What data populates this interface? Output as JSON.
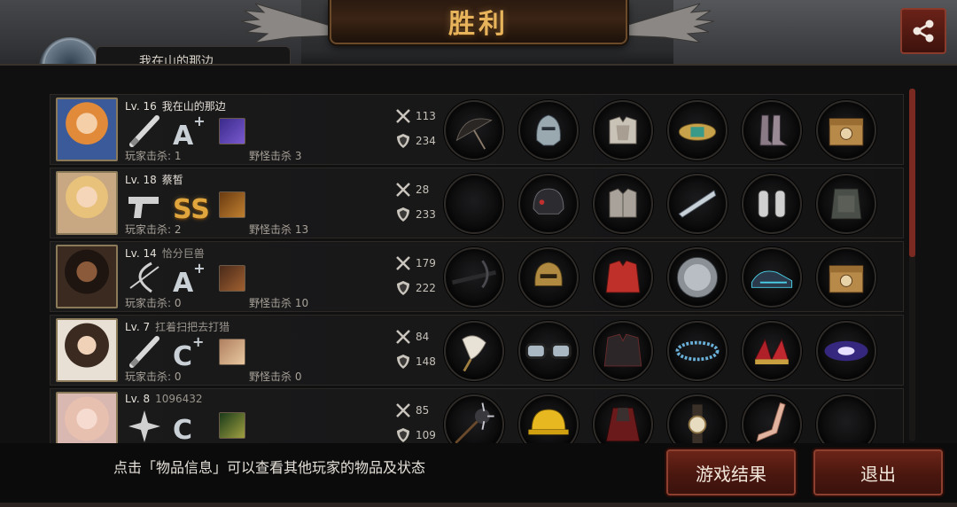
{
  "title": "胜利",
  "top_tab_text": "我在山的那边",
  "hint": "点击「物品信息」可以查看其他玩家的物品及状态",
  "buttons": {
    "result": "游戏结果",
    "exit": "退出"
  },
  "labels": {
    "player_kills": "玩家击杀",
    "monster_kills": "野怪击杀"
  },
  "colors": {
    "title": "#e7b35b",
    "button": "#6b2418",
    "ss_grade": "#e0a53c"
  },
  "players": [
    {
      "level": "Lv. 16",
      "name": "我在山的那边",
      "name_dim": false,
      "weapon": "bat-icon",
      "grade": "A",
      "grade_plus": "+",
      "grade_style": "normal",
      "skill": "skill-purple-icon",
      "player_kills": ": 1",
      "monster_kills": " 3",
      "attack": "113",
      "defense": "234",
      "items": [
        "umbrella-icon",
        "knight-helmet-icon",
        "plate-armor-icon",
        "gold-bracer-icon",
        "leather-boots-icon",
        "supply-crate-icon"
      ]
    },
    {
      "level": "Lv. 18",
      "name": "蔡皙",
      "name_dim": false,
      "weapon": "pistol-icon",
      "grade": "SS",
      "grade_plus": "",
      "grade_style": "ss",
      "skill": "skill-orange-icon",
      "player_kills": ": 2",
      "monster_kills": " 13",
      "attack": "28",
      "defense": "233",
      "items": [
        "",
        "tactical-helmet-icon",
        "chest-armor-icon",
        "drill-blade-icon",
        "knee-guards-icon",
        "vest-icon"
      ]
    },
    {
      "level": "Lv. 14",
      "name": "恰分巨兽",
      "name_dim": true,
      "weapon": "bow-icon",
      "grade": "A",
      "grade_plus": "+",
      "grade_style": "normal",
      "skill": "skill-cross-icon",
      "player_kills": ": 0",
      "monster_kills": " 10",
      "attack": "179",
      "defense": "222",
      "items": [
        "crossbow-icon",
        "bronze-helmet-icon",
        "red-jacket-icon",
        "steel-disc-icon",
        "blue-sneakers-icon",
        "supply-crate-icon"
      ]
    },
    {
      "level": "Lv. 7",
      "name": "扛着扫把去打猎",
      "name_dim": true,
      "weapon": "bat-icon",
      "grade": "C",
      "grade_plus": "+",
      "grade_style": "normal",
      "skill": "skill-portrait-icon",
      "player_kills": ": 0",
      "monster_kills": " 0",
      "attack": "84",
      "defense": "148",
      "items": [
        "feather-fan-icon",
        "glasses-icon",
        "black-coat-icon",
        "bead-bracelet-icon",
        "red-heels-icon",
        "galaxy-icon"
      ]
    },
    {
      "level": "Lv. 8",
      "name": "1096432",
      "name_dim": true,
      "weapon": "shuriken-icon",
      "grade": "C",
      "grade_plus": "",
      "grade_style": "normal",
      "skill": "skill-ninja-icon",
      "player_kills": "",
      "monster_kills": "",
      "attack": "85",
      "defense": "109",
      "items": [
        "spiked-mace-icon",
        "hard-hat-icon",
        "red-cloak-icon",
        "wrist-watch-icon",
        "leg-icon",
        ""
      ]
    }
  ]
}
